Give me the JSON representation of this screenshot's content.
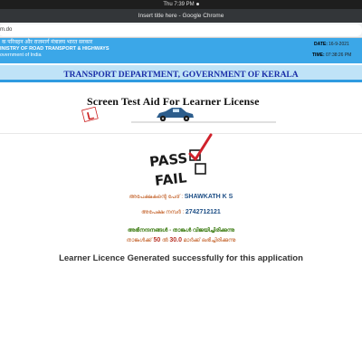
{
  "os_bar": {
    "clock": "Thu  7:39 PM"
  },
  "browser": {
    "window_title": "Insert title here - Google Chrome",
    "url_fragment": "m.do"
  },
  "header": {
    "hindi_line": "क परिवहन और राजमार्ग मंत्रालय भारत सरकार",
    "english_line1": "INISTRY OF ROAD TRANSPORT & HIGHWAYS",
    "english_line2": "overnment of India",
    "date_label": "DATE:",
    "date_value": "16-9-2021",
    "time_label": "TIME:",
    "time_value": "07:38:26 PM"
  },
  "department": {
    "title": "TRANSPORT DEPARTMENT, GOVERNMENT OF KERALA"
  },
  "logo": {
    "title": "Screen Test Aid For Learner License",
    "plate_letter": "L"
  },
  "result_graphic": {
    "pass_label": "PASS",
    "fail_label": "FAIL",
    "checked": "pass"
  },
  "applicant": {
    "name_label": "അപേക്ഷകന്റെ പേര് :",
    "name_value": "SHAWKATH K S",
    "appno_label": "അപേക്ഷ നമ്പർ :",
    "appno_value": "2742712121"
  },
  "result": {
    "congrats_text": "അഭിനന്ദനങ്ങൾ - താങ്കൾ വിജയിച്ചിരിക്കുന്നു",
    "score_prefix": "താങ്കൾക്ക്",
    "score_value": "50",
    "score_mid": "ൽ",
    "score_obtained": "30.0",
    "score_suffix": "മാർക്ക് ലഭിച്ചിരിക്കുന്നു"
  },
  "message": {
    "success_text": "Learner Licence Generated successfully for this application"
  },
  "colors": {
    "header_blue": "#3ba7e8",
    "banner_light": "#bfe3f7",
    "dept_text": "#1a2ea8",
    "check_red": "#d0212b"
  }
}
